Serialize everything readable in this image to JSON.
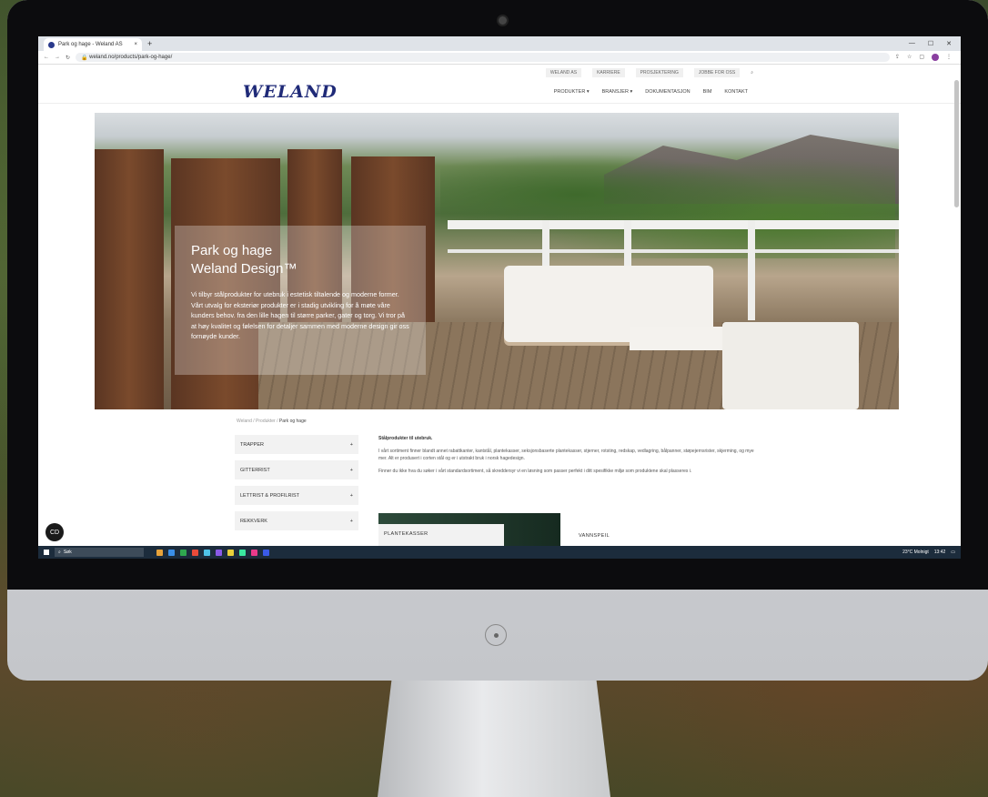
{
  "browser": {
    "tab_title": "Park og hage - Weland AS",
    "tab_close": "×",
    "new_tab": "+",
    "url": "weland.no/products/park-og-hage/",
    "window_controls": [
      "—",
      "☐",
      "✕"
    ]
  },
  "site": {
    "top_links": [
      "WELAND AS",
      "KARRIERE",
      "PROSJEKTERING",
      "JOBBE FOR OSS"
    ],
    "logo": "WELAND",
    "nav": [
      "PRODUKTER ▾",
      "BRANSJER ▾",
      "DOKUMENTASJON",
      "BIM",
      "KONTAKT"
    ]
  },
  "hero": {
    "title_line1": "Park og hage",
    "title_line2": "Weland Design™",
    "text": "Vi tilbyr stålprodukter for utebruk i estetisk tiltalende og moderne former. Vårt utvalg for eksteriør produkter er i stadig utvikling for å møte våre kunders behov. fra den lille hagen til større parker, gater og torg. Vi tror på at høy kvalitet og følelsen for detaljer sammen med moderne design gir oss fornøyde kunder."
  },
  "breadcrumb": {
    "home": "Weland",
    "sep": "/",
    "products": "Produkter",
    "current": "Park og hage"
  },
  "sidebar": {
    "items": [
      {
        "label": "TRAPPER",
        "plus": "+"
      },
      {
        "label": "GITTERRIST",
        "plus": "+"
      },
      {
        "label": "LETTRIST & PROFILRIST",
        "plus": "+"
      },
      {
        "label": "REKKVERK",
        "plus": "+"
      }
    ]
  },
  "main": {
    "heading": "Stålprodukter til utebruk.",
    "para1": "I vårt sortiment finner blandt annet rabattkanter, kantstål, plantekasser, seksjonsbaserte plantekasser, stjerner, rotsting, redskap, vedlagring, bålpanner, støpejernsrister, skjerming, og mye mer. Alt er produsert i corten stål og er i utstrakt bruk i norsk hagedesign.",
    "para2": "Finner du ikke hva du søker i vårt standardsortiment, så skreddersyr vi en løsning som passer perfekt i ditt spesifikke miljø som produktene skal plasseres i.",
    "card1": "PLANTEKASSER",
    "card2": "VANNSPEIL"
  },
  "chat_label": "CD",
  "taskbar": {
    "search": "Søk",
    "weather": "23°C Molnigt",
    "time": "13:42"
  },
  "icons": [
    "search-icon",
    "lock-icon",
    "star-icon",
    "profile-icon",
    "windows-start-icon",
    "chat-icon"
  ]
}
